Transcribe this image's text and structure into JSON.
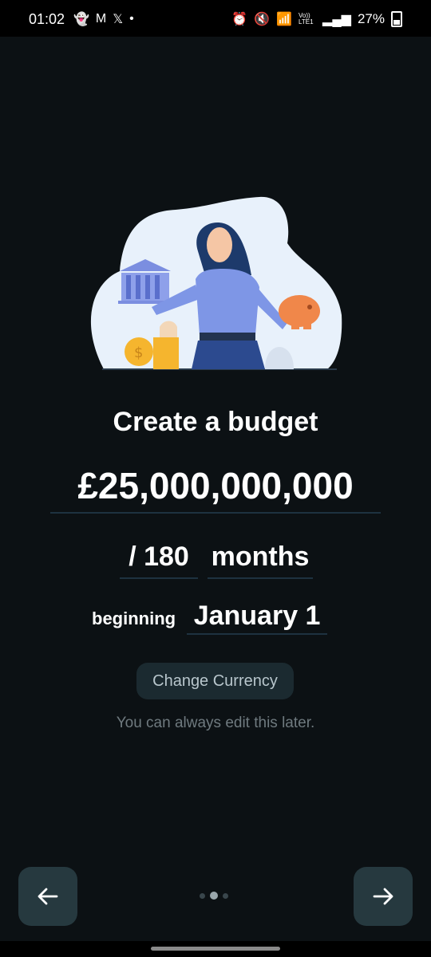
{
  "status_bar": {
    "time": "01:02",
    "left_icons": [
      "snapchat-icon",
      "gmail-icon",
      "x-icon",
      "dot-icon"
    ],
    "right_icons": [
      "alarm-icon",
      "mute-icon",
      "wifi-icon",
      "volte-icon",
      "signal-icon"
    ],
    "volte_label": "Vo)) LTE1",
    "battery": "27%"
  },
  "content": {
    "title": "Create a budget",
    "amount": "£25,000,000,000",
    "months_prefix": "/ 180",
    "months_unit": "months",
    "beginning_label": "beginning",
    "beginning_date": "January 1",
    "change_currency": "Change Currency",
    "hint": "You can always edit this later."
  },
  "navigation": {
    "back_icon": "arrow-left-icon",
    "next_icon": "arrow-right-icon",
    "pages": 3,
    "current_page": 2
  },
  "colors": {
    "background": "#0c1114",
    "button": "#26393f",
    "underline": "#1e3240"
  }
}
